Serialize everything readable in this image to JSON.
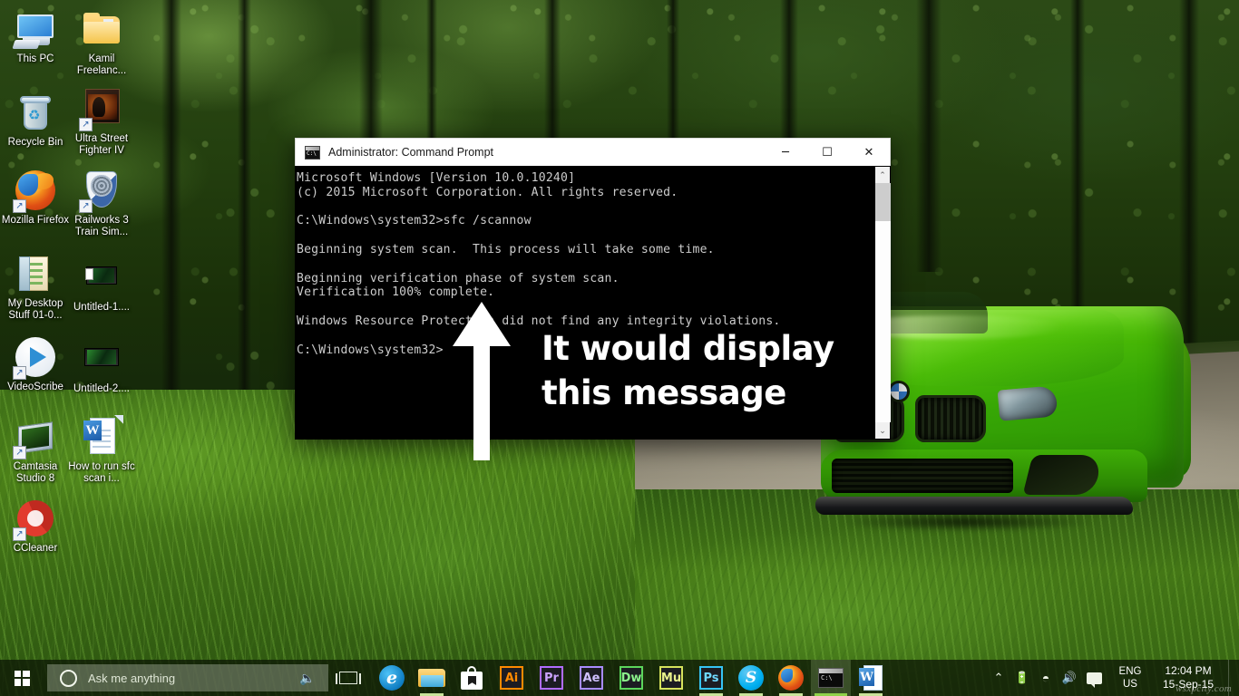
{
  "desktop": {
    "icons": [
      {
        "name": "this-pc",
        "label": "This PC",
        "shortcut": false
      },
      {
        "name": "kamil-freelance-folder",
        "label": "Kamil Freelanc...",
        "shortcut": false
      },
      {
        "name": "recycle-bin",
        "label": "Recycle Bin",
        "shortcut": false
      },
      {
        "name": "ultra-street-fighter-iv",
        "label": "Ultra Street Fighter IV",
        "shortcut": true
      },
      {
        "name": "mozilla-firefox",
        "label": "Mozilla Firefox",
        "shortcut": true
      },
      {
        "name": "railworks-3-train-sim",
        "label": "Railworks 3 Train Sim...",
        "shortcut": true
      },
      {
        "name": "my-desktop-stuff",
        "label": "My Desktop Stuff 01-0...",
        "shortcut": false
      },
      {
        "name": "untitled-1",
        "label": "Untitled-1....",
        "shortcut": false
      },
      {
        "name": "videoscribe",
        "label": "VideoScribe",
        "shortcut": true
      },
      {
        "name": "untitled-2",
        "label": "Untitled-2....",
        "shortcut": false
      },
      {
        "name": "camtasia-studio-8",
        "label": "Camtasia Studio 8",
        "shortcut": true
      },
      {
        "name": "how-to-run-sfc-scan-doc",
        "label": "How to run sfc scan i...",
        "shortcut": false
      },
      {
        "name": "ccleaner",
        "label": "CCleaner",
        "shortcut": true
      }
    ]
  },
  "cmd_window": {
    "title": "Administrator: Command Prompt",
    "minimize_label": "─",
    "maximize_label": "☐",
    "close_label": "✕",
    "scroll_up_label": "⌃",
    "scroll_down_label": "⌄",
    "lines": [
      "Microsoft Windows [Version 10.0.10240]",
      "(c) 2015 Microsoft Corporation. All rights reserved.",
      "",
      "C:\\Windows\\system32>sfc /scannow",
      "",
      "Beginning system scan.  This process will take some time.",
      "",
      "Beginning verification phase of system scan.",
      "Verification 100% complete.",
      "",
      "Windows Resource Protection did not find any integrity violations.",
      "",
      "C:\\Windows\\system32>"
    ]
  },
  "annotation": {
    "line1": "It would display",
    "line2": "this message",
    "arrow_name": "up-arrow-annotation"
  },
  "taskbar": {
    "start_label": "Start",
    "search_placeholder": "Ask me anything",
    "mic_label": "⮕",
    "apps": [
      {
        "name": "taskbar-edge",
        "label": "e",
        "kind": "edge",
        "open": false
      },
      {
        "name": "taskbar-file-explorer",
        "label": "File Explorer",
        "kind": "explorer",
        "open": true
      },
      {
        "name": "taskbar-store",
        "label": "Store",
        "kind": "store",
        "open": false
      },
      {
        "name": "taskbar-illustrator",
        "label": "Ai",
        "kind": "adobe",
        "color": "#ff8a00",
        "open": false
      },
      {
        "name": "taskbar-premiere-pro",
        "label": "Pr",
        "kind": "adobe",
        "color": "#b06cff",
        "open": false
      },
      {
        "name": "taskbar-after-effects",
        "label": "Ae",
        "kind": "adobe",
        "color": "#a98cff",
        "open": false
      },
      {
        "name": "taskbar-dreamweaver",
        "label": "Dw",
        "kind": "adobe",
        "color": "#5cd65c",
        "open": false
      },
      {
        "name": "taskbar-muse",
        "label": "Mu",
        "kind": "adobe",
        "color": "#d6e25c",
        "open": false
      },
      {
        "name": "taskbar-photoshop",
        "label": "Ps",
        "kind": "adobe",
        "color": "#36c4f5",
        "open": true
      },
      {
        "name": "taskbar-skype",
        "label": "S",
        "kind": "skype",
        "open": true
      },
      {
        "name": "taskbar-firefox",
        "label": "Firefox",
        "kind": "firefox",
        "open": true
      },
      {
        "name": "taskbar-command-prompt",
        "label": "C:\\",
        "kind": "cmd",
        "open": true,
        "active": true
      },
      {
        "name": "taskbar-word",
        "label": "W",
        "kind": "word",
        "open": true
      }
    ],
    "tray": {
      "chevron": "⌃",
      "battery": "🔋",
      "wifi": "◴",
      "volume": "🔊",
      "language_line1": "ENG",
      "language_line2": "US",
      "time": "12:04 PM",
      "date": "15-Sep-15"
    },
    "watermark": "wsxpcity.com"
  },
  "colors": {
    "taskbar_bg": "#0e1806",
    "console_bg": "#000000",
    "console_text": "#cccccc",
    "titlebar_bg": "#ffffff",
    "accent_green": "#4fbe07"
  }
}
